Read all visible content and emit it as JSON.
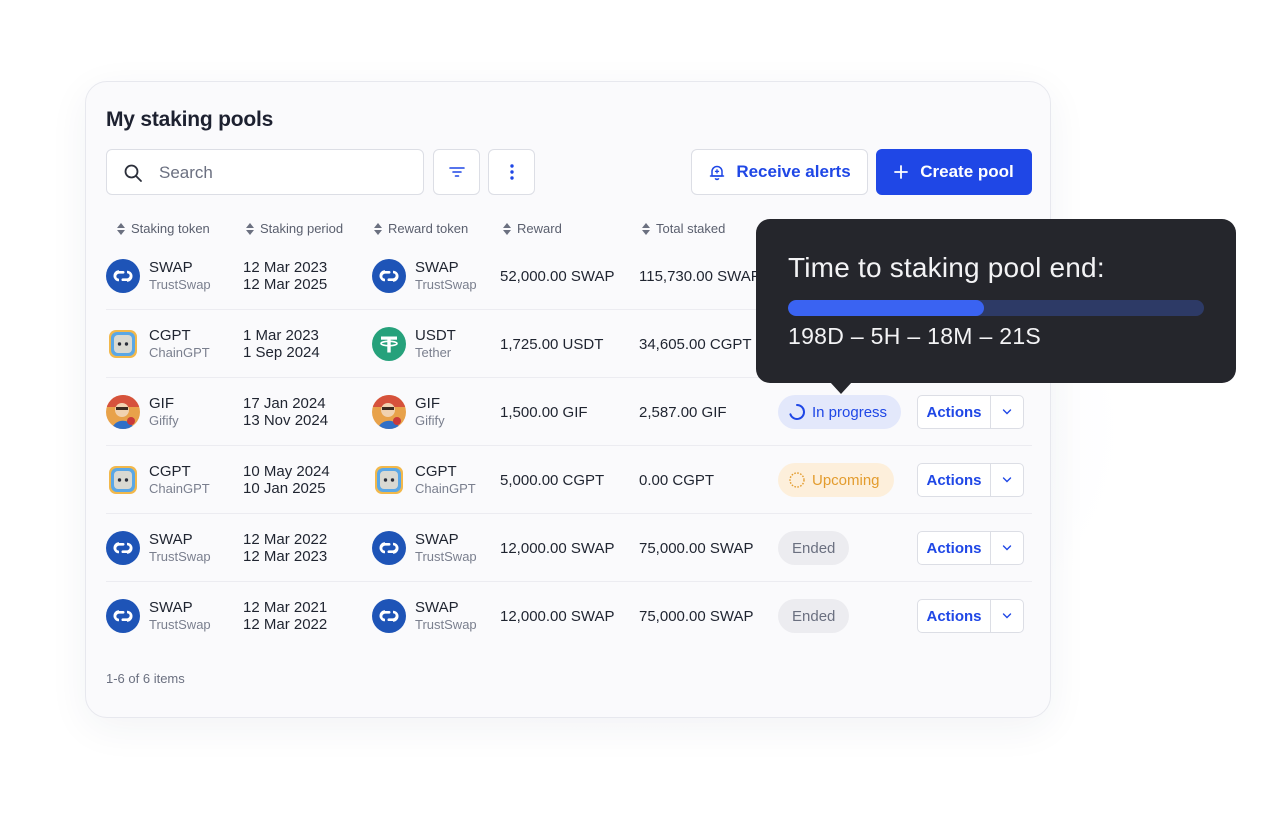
{
  "page_title": "My staking pools",
  "search": {
    "placeholder": "Search",
    "value": ""
  },
  "buttons": {
    "receive_alerts": "Receive alerts",
    "create_pool": "Create pool"
  },
  "columns": [
    "Staking token",
    "Staking period",
    "Reward token",
    "Reward",
    "Total staked"
  ],
  "rows": [
    {
      "stake_symbol": "SWAP",
      "stake_name": "TrustSwap",
      "stake_logo": "trustswap-logo",
      "start": "12 Mar 2023",
      "end": "12 Mar 2025",
      "reward_symbol": "SWAP",
      "reward_name": "TrustSwap",
      "reward_logo": "trustswap-logo",
      "reward": "52,000.00 SWAP",
      "total": "115,730.00 SWAP",
      "status": "",
      "action": ""
    },
    {
      "stake_symbol": "CGPT",
      "stake_name": "ChainGPT",
      "stake_logo": "chaingpt-logo",
      "start": "1 Mar 2023",
      "end": "1 Sep 2024",
      "reward_symbol": "USDT",
      "reward_name": "Tether",
      "reward_logo": "tether-logo",
      "reward": "1,725.00 USDT",
      "total": "34,605.00 CGPT",
      "status": "",
      "action": ""
    },
    {
      "stake_symbol": "GIF",
      "stake_name": "Gifify",
      "stake_logo": "gifify-logo",
      "start": "17 Jan 2024",
      "end": "13 Nov 2024",
      "reward_symbol": "GIF",
      "reward_name": "Gifify",
      "reward_logo": "gifify-logo",
      "reward": "1,500.00 GIF",
      "total": "2,587.00 GIF",
      "status": "In progress",
      "action": "Actions"
    },
    {
      "stake_symbol": "CGPT",
      "stake_name": "ChainGPT",
      "stake_logo": "chaingpt-logo",
      "start": "10 May 2024",
      "end": "10 Jan 2025",
      "reward_symbol": "CGPT",
      "reward_name": "ChainGPT",
      "reward_logo": "chaingpt-logo",
      "reward": "5,000.00 CGPT",
      "total": "0.00 CGPT",
      "status": "Upcoming",
      "action": "Actions"
    },
    {
      "stake_symbol": "SWAP",
      "stake_name": "TrustSwap",
      "stake_logo": "trustswap-logo",
      "start": "12 Mar 2022",
      "end": "12 Mar 2023",
      "reward_symbol": "SWAP",
      "reward_name": "TrustSwap",
      "reward_logo": "trustswap-logo",
      "reward": "12,000.00 SWAP",
      "total": "75,000.00 SWAP",
      "status": "Ended",
      "action": "Actions"
    },
    {
      "stake_symbol": "SWAP",
      "stake_name": "TrustSwap",
      "stake_logo": "trustswap-logo",
      "start": "12 Mar 2021",
      "end": "12 Mar 2022",
      "reward_symbol": "SWAP",
      "reward_name": "TrustSwap",
      "reward_logo": "trustswap-logo",
      "reward": "12,000.00 SWAP",
      "total": "75,000.00 SWAP",
      "status": "Ended",
      "action": "Actions"
    }
  ],
  "pagination": "1-6 of 6 items",
  "tooltip": {
    "title": "Time to staking pool end:",
    "progress": 0.47,
    "countdown": "198D – 5H – 18M – 21S"
  },
  "colors": {
    "primary": "#1f47e6",
    "in_progress_bg": "#e3e8fb",
    "upcoming": "#e39c2e",
    "upcoming_bg": "#fdefdb",
    "ended_bg": "#ececf0",
    "tooltip_bg": "#25262c"
  },
  "icons": {
    "search": "search-icon",
    "filter": "filter-icon",
    "more": "more-vertical-icon",
    "alert": "bell-icon",
    "create": "plus-icon",
    "sort": "sort-icon",
    "dropdown": "chevron-down-icon"
  }
}
